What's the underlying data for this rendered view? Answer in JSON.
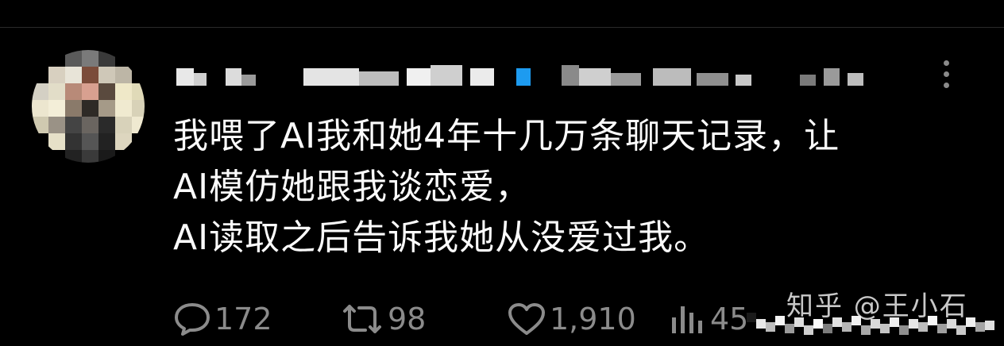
{
  "tweet": {
    "lines": [
      "我喂了AI我和她4年十几万条聊天记录，让",
      "AI模仿她跟我谈恋爱，",
      "AI读取之后告诉我她从没爱过我。"
    ]
  },
  "actions": {
    "reply_count": "172",
    "retweet_count": "98",
    "like_count": "1,910",
    "views_count": "45"
  },
  "watermark": {
    "text": "知乎 @王小石"
  },
  "icons": {
    "more": "more-vertical-icon",
    "reply": "comment-bubble-icon",
    "retweet": "retweet-icon",
    "like": "heart-icon",
    "views": "bar-chart-icon"
  },
  "colors": {
    "background": "#000000",
    "text": "#fbfbfb",
    "muted": "#8b8b8b",
    "accent": "#1d9bf0"
  }
}
